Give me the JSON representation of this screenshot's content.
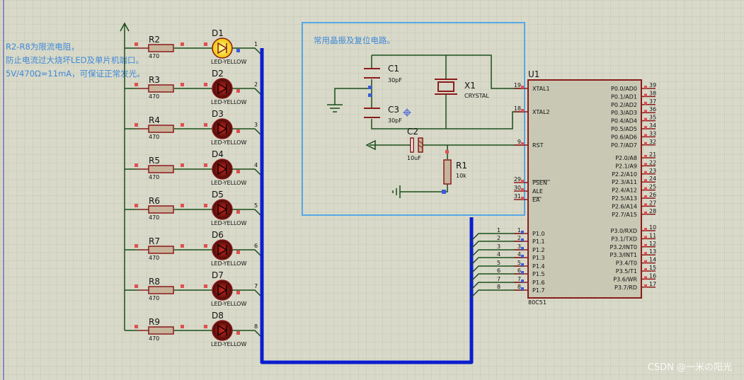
{
  "note": {
    "lines": [
      "R2-R8为限流电阻，",
      "防止电流过大烧坏LED及单片机端口。",
      "5V/470Ω≈11mA，可保证正常发光。"
    ]
  },
  "osc_box": {
    "title": "常用晶振及复位电路。"
  },
  "leds": [
    {
      "ref": "D1",
      "type": "LED-YELLOW",
      "lit": true,
      "res_ref": "R2",
      "res_val": "470",
      "net": "1"
    },
    {
      "ref": "D2",
      "type": "LED-YELLOW",
      "lit": false,
      "res_ref": "R3",
      "res_val": "470",
      "net": "2"
    },
    {
      "ref": "D3",
      "type": "LED-YELLOW",
      "lit": false,
      "res_ref": "R4",
      "res_val": "470",
      "net": "3"
    },
    {
      "ref": "D4",
      "type": "LED-YELLOW",
      "lit": false,
      "res_ref": "R5",
      "res_val": "470",
      "net": "4"
    },
    {
      "ref": "D5",
      "type": "LED-YELLOW",
      "lit": false,
      "res_ref": "R6",
      "res_val": "470",
      "net": "5"
    },
    {
      "ref": "D6",
      "type": "LED-YELLOW",
      "lit": false,
      "res_ref": "R7",
      "res_val": "470",
      "net": "6"
    },
    {
      "ref": "D7",
      "type": "LED-YELLOW",
      "lit": false,
      "res_ref": "R8",
      "res_val": "470",
      "net": "7"
    },
    {
      "ref": "D8",
      "type": "LED-YELLOW",
      "lit": false,
      "res_ref": "R9",
      "res_val": "470",
      "net": "8"
    }
  ],
  "parts": {
    "c1": {
      "ref": "C1",
      "value": "30pF"
    },
    "c3": {
      "ref": "C3",
      "value": "30pF"
    },
    "x1": {
      "ref": "X1",
      "value": "CRYSTAL"
    },
    "c2": {
      "ref": "C2",
      "value": "10uF"
    },
    "r1": {
      "ref": "R1",
      "value": "10k"
    }
  },
  "mcu": {
    "ref": "U1",
    "part": "80C51",
    "left_pins": [
      {
        "num": "19",
        "name": "XTAL1"
      },
      {
        "num": "18",
        "name": "XTAL2"
      },
      {
        "num": "9",
        "name": "RST"
      },
      {
        "num": "29",
        "name": "PSEN"
      },
      {
        "num": "30",
        "name": "ALE"
      },
      {
        "num": "31",
        "name": "EA"
      },
      {
        "num": "1",
        "name": "P1.0"
      },
      {
        "num": "2",
        "name": "P1.1"
      },
      {
        "num": "3",
        "name": "P1.2"
      },
      {
        "num": "4",
        "name": "P1.3"
      },
      {
        "num": "5",
        "name": "P1.4"
      },
      {
        "num": "6",
        "name": "P1.5"
      },
      {
        "num": "7",
        "name": "P1.6"
      },
      {
        "num": "8",
        "name": "P1.7"
      }
    ],
    "right_pins": [
      {
        "num": "39",
        "name": "P0.0/AD0"
      },
      {
        "num": "38",
        "name": "P0.1/AD1"
      },
      {
        "num": "37",
        "name": "P0.2/AD2"
      },
      {
        "num": "36",
        "name": "P0.3/AD3"
      },
      {
        "num": "35",
        "name": "P0.4/AD4"
      },
      {
        "num": "34",
        "name": "P0.5/AD5"
      },
      {
        "num": "33",
        "name": "P0.6/AD6"
      },
      {
        "num": "32",
        "name": "P0.7/AD7"
      },
      {
        "num": "21",
        "name": "P2.0/A8"
      },
      {
        "num": "22",
        "name": "P2.1/A9"
      },
      {
        "num": "23",
        "name": "P2.2/A10"
      },
      {
        "num": "24",
        "name": "P2.3/A11"
      },
      {
        "num": "25",
        "name": "P2.4/A12"
      },
      {
        "num": "26",
        "name": "P2.5/A13"
      },
      {
        "num": "27",
        "name": "P2.6/A14"
      },
      {
        "num": "28",
        "name": "P2.7/A15"
      },
      {
        "num": "10",
        "name": "P3.0/RXD"
      },
      {
        "num": "11",
        "name": "P3.1/TXD"
      },
      {
        "num": "12",
        "name": "P3.2/INT0"
      },
      {
        "num": "13",
        "name": "P3.3/INT1"
      },
      {
        "num": "14",
        "name": "P3.4/T0"
      },
      {
        "num": "15",
        "name": "P3.5/T1"
      },
      {
        "num": "16",
        "name": "P3.6/WR"
      },
      {
        "num": "17",
        "name": "P3.7/RD"
      }
    ]
  },
  "bus_labels": [
    "1",
    "2",
    "3",
    "4",
    "5",
    "6",
    "7",
    "8"
  ],
  "watermark": "CSDN @一米の阳光",
  "colors": {
    "background": "#d9d9c9",
    "wire": "#1a4d1a",
    "bus": "#0a1ecf",
    "component": "#8b1a1a",
    "text_blue": "#3f8ad8",
    "box": "#56a7e6"
  }
}
